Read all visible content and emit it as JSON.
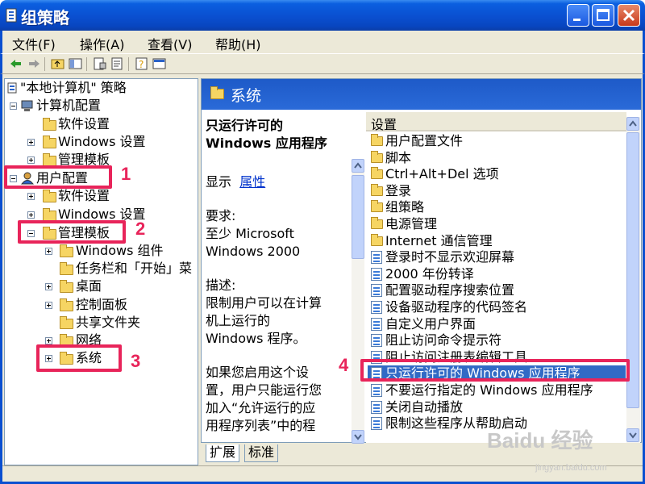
{
  "window": {
    "title": "组策略"
  },
  "menu": [
    "文件(F)",
    "操作(A)",
    "查看(V)",
    "帮助(H)"
  ],
  "tree": {
    "root": "\"本地计算机\" 策略",
    "computer_config": "计算机配置",
    "software_settings": "软件设置",
    "windows_settings": "Windows 设置",
    "admin_templates": "管理模板",
    "user_config": "用户配置",
    "user_software_settings": "软件设置",
    "user_windows_settings": "Windows 设置",
    "user_admin_templates": "管理模板",
    "children": [
      "Windows 组件",
      "任务栏和「开始」菜",
      "桌面",
      "控制面板",
      "共享文件夹",
      "网络",
      "系统"
    ]
  },
  "right_pane": {
    "header": "系统"
  },
  "description": {
    "title_line1": "只运行许可的",
    "title_line2": "Windows 应用程序",
    "show_label": "显示",
    "properties_link": "属性",
    "requirements_label": "要求:",
    "req_line1": "至少 Microsoft",
    "req_line2": "Windows 2000",
    "desc_label": "描述:",
    "desc_line1": "限制用户可以在计算",
    "desc_line2": "机上运行的",
    "desc_line3": "Windows 程序。",
    "desc_line4": "如果您启用这个设",
    "desc_line5": "置，用户只能运行您",
    "desc_line6": "加入“允许运行的应",
    "desc_line7": "用程序列表”中的程"
  },
  "settings": {
    "column_header": "设置",
    "items": [
      {
        "label": "用户配置文件",
        "icon": "folder-icon"
      },
      {
        "label": "脚本",
        "icon": "folder-icon"
      },
      {
        "label": "Ctrl+Alt+Del 选项",
        "icon": "folder-icon"
      },
      {
        "label": "登录",
        "icon": "folder-icon"
      },
      {
        "label": "组策略",
        "icon": "folder-icon"
      },
      {
        "label": "电源管理",
        "icon": "folder-icon"
      },
      {
        "label": "Internet 通信管理",
        "icon": "folder-icon"
      },
      {
        "label": "登录时不显示欢迎屏幕",
        "icon": "policy-icon"
      },
      {
        "label": "2000 年份转译",
        "icon": "policy-icon"
      },
      {
        "label": "配置驱动程序搜索位置",
        "icon": "policy-icon"
      },
      {
        "label": "设备驱动程序的代码签名",
        "icon": "policy-icon"
      },
      {
        "label": "自定义用户界面",
        "icon": "policy-icon"
      },
      {
        "label": "阻止访问命令提示符",
        "icon": "policy-icon"
      },
      {
        "label": "阻止访问注册表编辑工具",
        "icon": "policy-icon"
      },
      {
        "label": "只运行许可的 Windows 应用程序",
        "icon": "policy-icon",
        "selected": true
      },
      {
        "label": "不要运行指定的 Windows 应用程序",
        "icon": "policy-icon"
      },
      {
        "label": "关闭自动播放",
        "icon": "policy-icon"
      },
      {
        "label": "限制这些程序从帮助启动",
        "icon": "policy-icon"
      }
    ]
  },
  "tabs": [
    "扩展",
    "标准"
  ],
  "annotations": [
    "1",
    "2",
    "3",
    "4"
  ],
  "watermark": {
    "text": "Baidu 经验",
    "sub": "jingyan.baidu.com"
  },
  "colors": {
    "accent": "#e8245a",
    "titlebar": "#0a4fd0",
    "selection": "#316ac5"
  }
}
